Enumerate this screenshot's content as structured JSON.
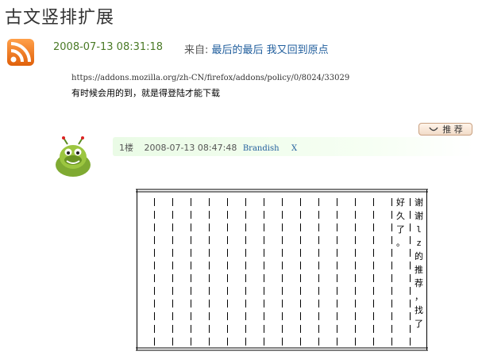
{
  "page": {
    "title": "古文竖排扩展"
  },
  "post": {
    "date": "2008-07-13 08:31:18",
    "source_prefix": "来自:",
    "source_link": "最后的最后  我又回到原点",
    "url": "https://addons.mozilla.org/zh-CN/firefox/addons/policy/0/8024/33029",
    "body": "有时候会用的到，就是得登陆才能下载"
  },
  "recommend": {
    "label": "推 荐"
  },
  "reply": {
    "floor": "1楼",
    "date": "2008-07-13 08:47:48",
    "author": "Brandish",
    "close": "X",
    "columns": [
      [
        "谢",
        "谢",
        "l",
        "z",
        "的",
        "推",
        "荐",
        "，",
        "找",
        "了"
      ],
      [
        "好",
        "久",
        "了",
        "。"
      ]
    ]
  },
  "colors": {
    "date_green": "#4a7a26",
    "link_blue": "#1f5d9c",
    "reply_bar_green": "#eafbe6",
    "rss_orange": "#f07a1a"
  },
  "icons": {
    "rss": "rss-icon",
    "avatar": "green-caterpillar-avatar",
    "recommend": "smile-icon"
  }
}
